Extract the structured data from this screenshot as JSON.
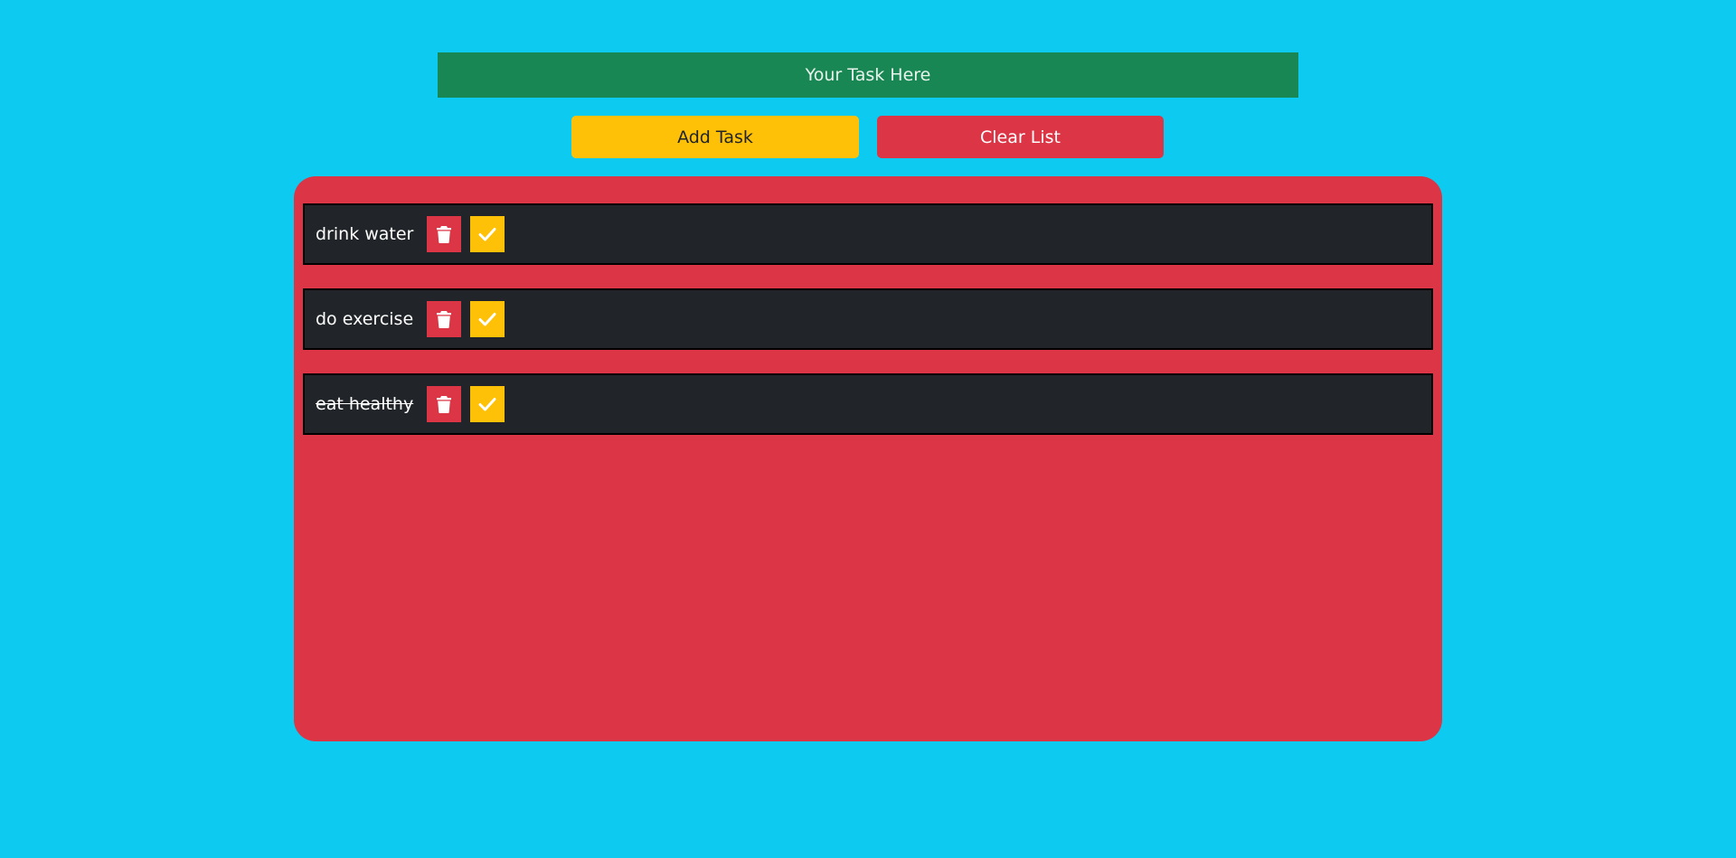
{
  "input": {
    "placeholder": "Your Task Here",
    "value": ""
  },
  "buttons": {
    "add_label": "Add Task",
    "clear_label": "Clear List"
  },
  "tasks": [
    {
      "text": "drink water",
      "completed": false
    },
    {
      "text": "do exercise",
      "completed": false
    },
    {
      "text": "eat healthy",
      "completed": true
    }
  ],
  "icons": {
    "delete": "trash-icon",
    "complete": "check-icon"
  },
  "colors": {
    "background": "#0dcaf0",
    "input_bg": "#198754",
    "add_button": "#ffc107",
    "clear_button": "#dc3545",
    "panel": "#dc3545",
    "task_row": "#212529"
  }
}
